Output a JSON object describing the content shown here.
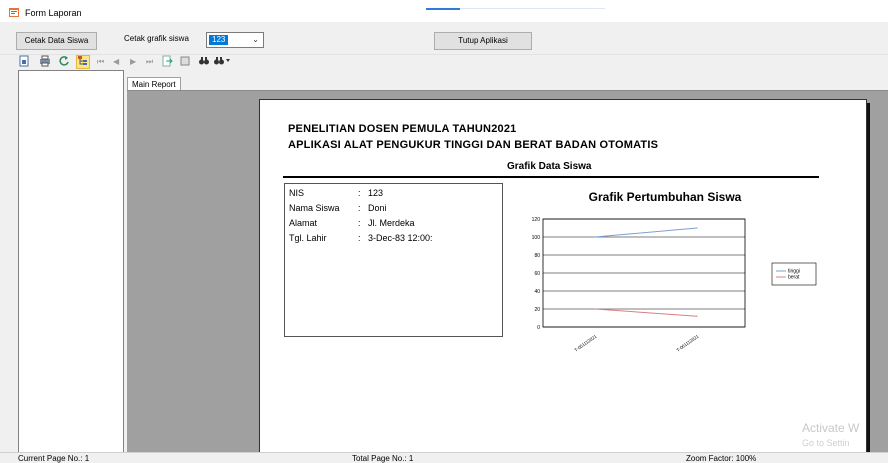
{
  "window": {
    "title": "Form Laporan"
  },
  "controls": {
    "cetak_data_siswa": "Cetak Data Siswa",
    "cetak_grafik_label": "Cetak grafik siswa",
    "combo_value": "123",
    "tutup_aplikasi": "Tutup Aplikasi"
  },
  "viewer": {
    "tab_label": "Main Report",
    "status": {
      "current_page": "Current Page No.: 1",
      "total_page": "Total Page No.: 1",
      "zoom": "Zoom Factor: 100%"
    }
  },
  "report": {
    "title_line1": "PENELITIAN DOSEN PEMULA TAHUN2021",
    "title_line2": "APLIKASI ALAT PENGUKUR TINGGI DAN BERAT BADAN OTOMATIS",
    "subtitle": "Grafik Data Siswa",
    "info": [
      {
        "label": "NIS",
        "value": "123"
      },
      {
        "label": "Nama Siswa",
        "value": "Doni"
      },
      {
        "label": "Alamat",
        "value": "Jl. Merdeka"
      },
      {
        "label": "Tgl. Lahir",
        "value": "3-Dec-83  12:00:"
      }
    ],
    "info_separator": ":"
  },
  "watermark": {
    "line1": "Activate W",
    "line2": "Go to Settin"
  },
  "icons": [
    "form-app-icon",
    "export-icon",
    "print-icon",
    "refresh-icon",
    "group-tree-icon",
    "first-page-icon",
    "prev-page-icon",
    "next-page-icon",
    "last-page-icon",
    "goto-page-icon",
    "stop-icon",
    "search-icon",
    "zoom-icon"
  ],
  "colors": {
    "tinggi": "#7f9fcf",
    "berat": "#d98080",
    "accent": "#2f7bd6"
  },
  "chart_data": {
    "type": "line",
    "title": "Grafik Pertumbuhan Siswa",
    "categories": [
      "T-05/11/2021",
      "T-06/11/2021"
    ],
    "category_labels": [
      "T-051112021",
      "T-061112021"
    ],
    "series": [
      {
        "name": "tinggi",
        "values": [
          100,
          110
        ]
      },
      {
        "name": "berat",
        "values": [
          20,
          12
        ]
      }
    ],
    "yticks": [
      0,
      20,
      40,
      60,
      80,
      100,
      120
    ],
    "ylim": [
      0,
      120
    ],
    "grid": true,
    "legend": "right"
  }
}
